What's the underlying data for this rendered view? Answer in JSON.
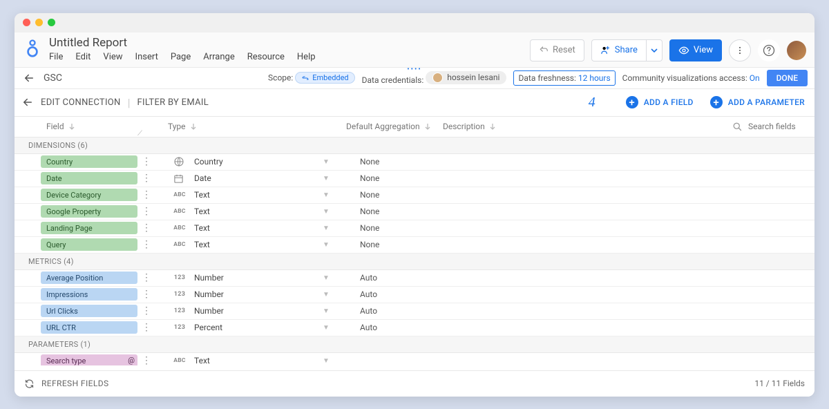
{
  "doc_title": "Untitled Report",
  "menu": [
    "File",
    "Edit",
    "View",
    "Insert",
    "Page",
    "Arrange",
    "Resource",
    "Help"
  ],
  "top_actions": {
    "reset": "Reset",
    "share": "Share",
    "view": "View"
  },
  "infobar": {
    "source": "GSC",
    "scope_label": "Scope:",
    "scope_value": "Embedded",
    "credentials_label": "Data credentials:",
    "credentials_user": "hossein lesani",
    "freshness_label": "Data freshness: ",
    "freshness_value": "12 hours",
    "cv_label": "Community visualizations access: ",
    "cv_value": "On",
    "done": "DONE"
  },
  "actionbar": {
    "edit_connection": "EDIT CONNECTION",
    "filter": "FILTER BY EMAIL",
    "callout": "4",
    "add_field": "ADD A FIELD",
    "add_parameter": "ADD A PARAMETER"
  },
  "columns": {
    "field": "Field",
    "type": "Type",
    "agg": "Default Aggregation",
    "desc": "Description",
    "search_placeholder": "Search fields"
  },
  "sections": {
    "dimensions": {
      "title": "DIMENSIONS (6)",
      "items": [
        {
          "name": "Country",
          "icon": "globe",
          "type": "Country",
          "agg": "None"
        },
        {
          "name": "Date",
          "icon": "calendar",
          "type": "Date",
          "agg": "None"
        },
        {
          "name": "Device Category",
          "icon": "abc",
          "type": "Text",
          "agg": "None"
        },
        {
          "name": "Google Property",
          "icon": "abc",
          "type": "Text",
          "agg": "None"
        },
        {
          "name": "Landing Page",
          "icon": "abc",
          "type": "Text",
          "agg": "None"
        },
        {
          "name": "Query",
          "icon": "abc",
          "type": "Text",
          "agg": "None"
        }
      ]
    },
    "metrics": {
      "title": "METRICS (4)",
      "items": [
        {
          "name": "Average Position",
          "icon": "num",
          "type": "Number",
          "agg": "Auto"
        },
        {
          "name": "Impressions",
          "icon": "num",
          "type": "Number",
          "agg": "Auto"
        },
        {
          "name": "Url Clicks",
          "icon": "num",
          "type": "Number",
          "agg": "Auto"
        },
        {
          "name": "URL CTR",
          "icon": "num",
          "type": "Percent",
          "agg": "Auto"
        }
      ]
    },
    "parameters": {
      "title": "PARAMETERS (1)",
      "items": [
        {
          "name": "Search type",
          "icon": "abc",
          "type": "Text",
          "agg": ""
        }
      ]
    }
  },
  "footer": {
    "refresh": "REFRESH FIELDS",
    "count": "11 / 11 Fields"
  }
}
